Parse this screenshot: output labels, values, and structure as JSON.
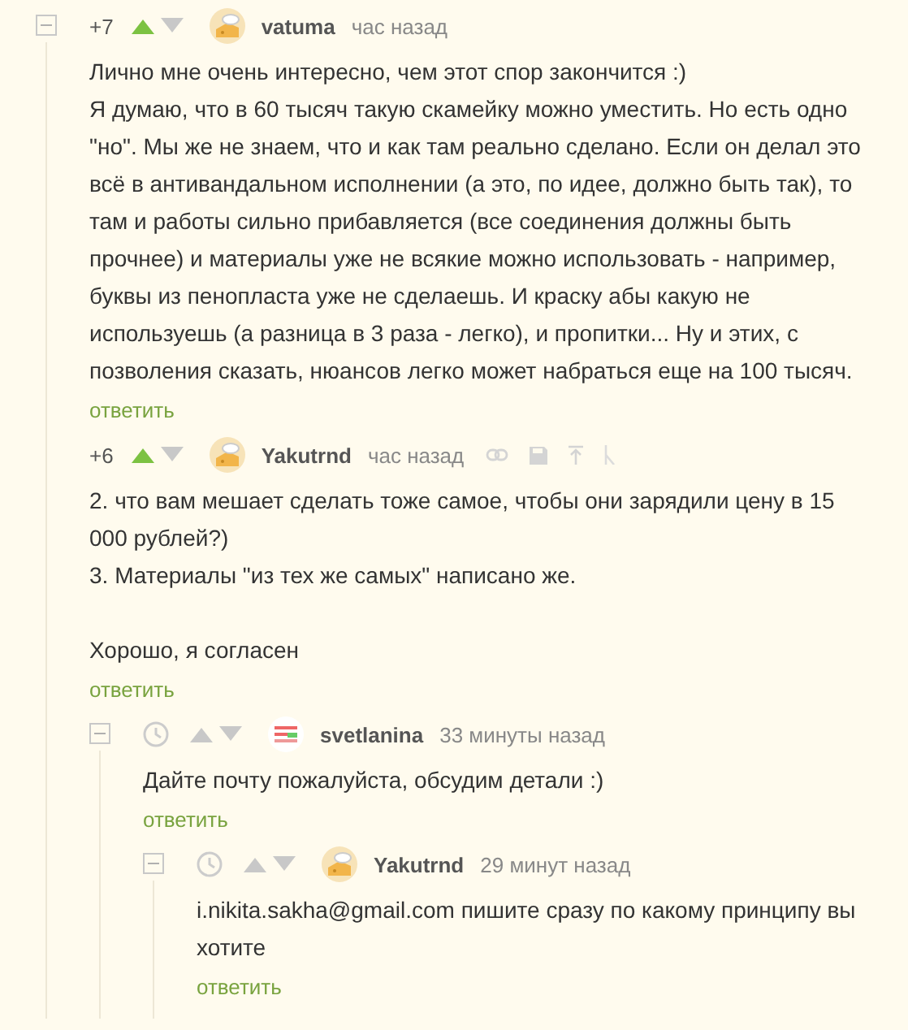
{
  "comments": [
    {
      "collapsible": true,
      "rating": "+7",
      "upvoted": true,
      "avatar": {
        "kind": "cheese"
      },
      "author": "vatuma",
      "time": "час назад",
      "paragraphs": [
        "Лично мне очень интересно, чем этот спор закончится :)",
        "Я думаю, что в 60 тысяч такую скамейку можно уместить. Но есть одно \"но\". Мы же не знаем, что и как там реально сделано. Если он делал это всё в антивандальном исполнении (а это, по идее, должно быть так), то там и работы сильно прибавляется (все соединения должны быть прочнее) и материалы уже не всякие можно использовать - например, буквы из пенопласта уже не сделаешь. И краску абы какую не используешь (а разница в 3 раза - легко), и пропитки... Ну и этих, с позволения сказать, нюансов легко может набраться еще на 100 тысяч."
      ],
      "reply": "ответить",
      "children": [
        {
          "rating": "+6",
          "upvoted": true,
          "avatar": {
            "kind": "cheese"
          },
          "author": "Yakutrnd",
          "time": "час назад",
          "actions": true,
          "paragraphs": [
            "2. что вам мешает сделать тоже самое, чтобы они зарядили цену в 15 000 рублей?)",
            "3. Материалы \"из тех же самых\" написано же.",
            "Хорошо, я согласен"
          ],
          "reply": "ответить",
          "children": [
            {
              "collapsible": true,
              "avatar": {
                "kind": "stripes"
              },
              "author": "svetlanina",
              "time": "33 минуты назад",
              "upvoted": false,
              "paragraphs": [
                "Дайте почту пожалуйста, обсудим детали :)"
              ],
              "reply": "ответить",
              "children": [
                {
                  "collapsible": true,
                  "avatar": {
                    "kind": "cheese"
                  },
                  "author": "Yakutrnd",
                  "time": "29 минут назад",
                  "upvoted": false,
                  "paragraphs": [
                    "i.nikita.sakha@gmail.com пишите сразу по какому принципу вы хотите"
                  ],
                  "reply": "ответить"
                }
              ]
            }
          ]
        }
      ]
    }
  ]
}
